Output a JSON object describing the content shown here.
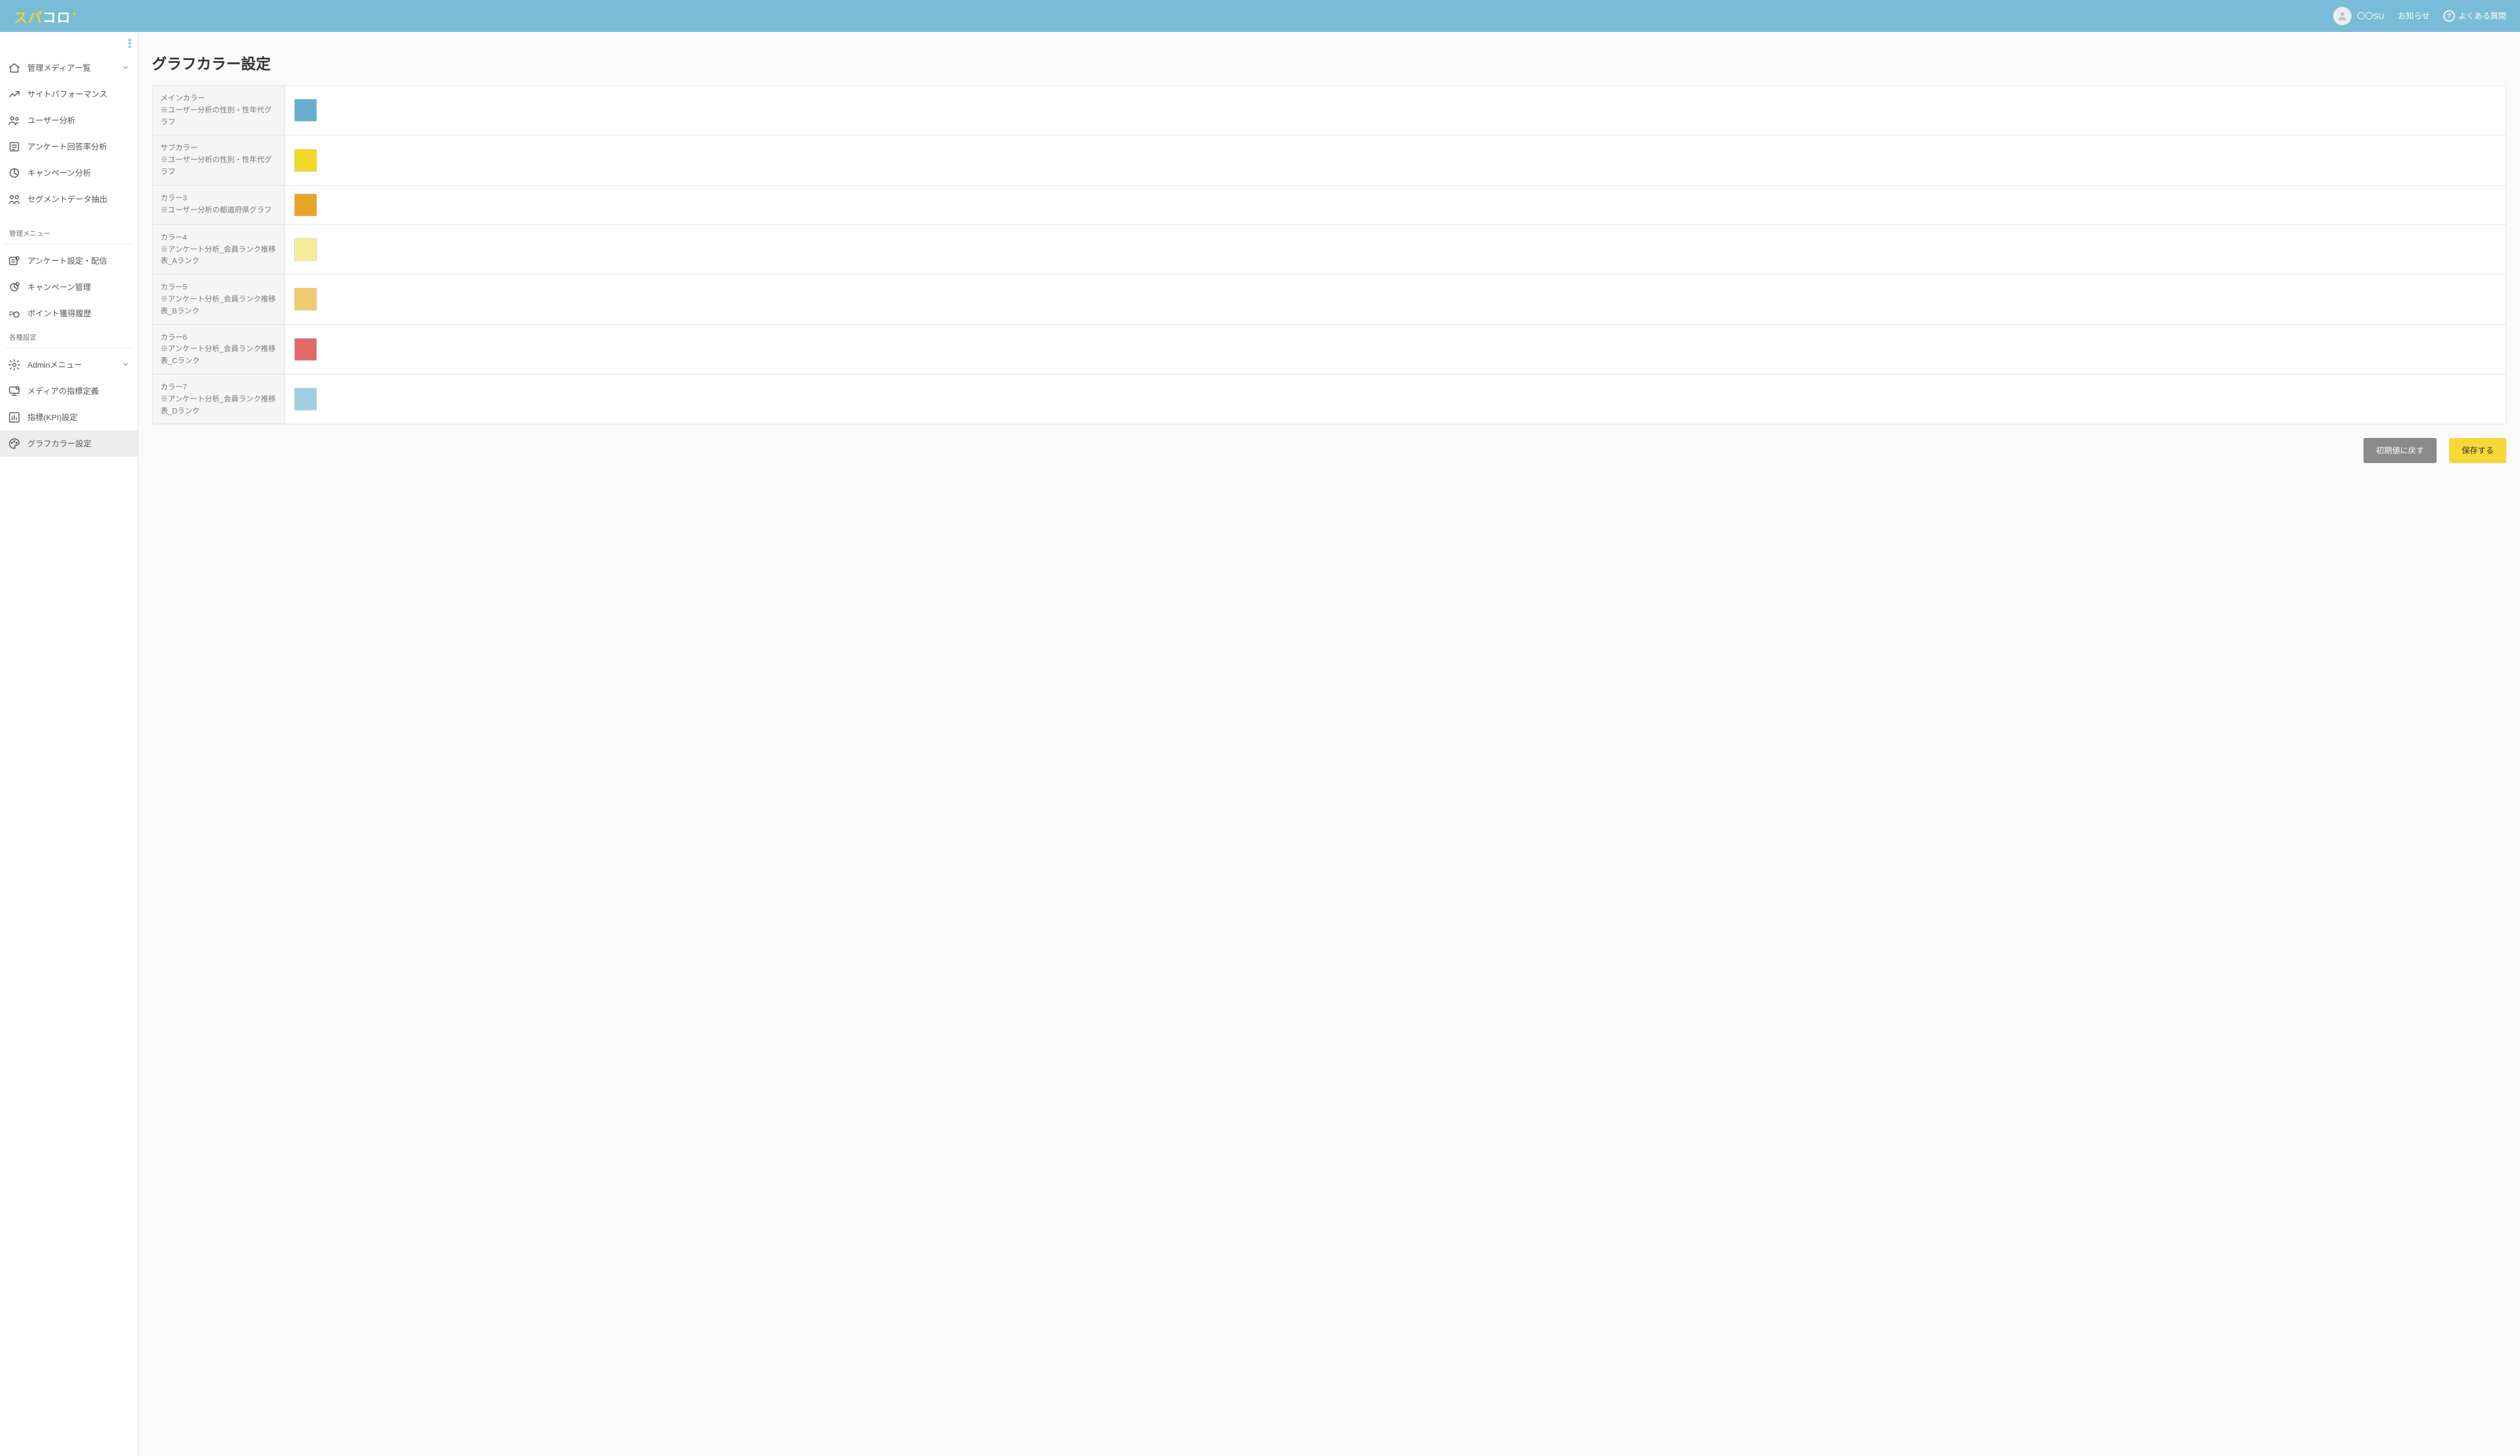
{
  "header": {
    "logo_left": "スパ",
    "logo_right": "コロ",
    "logo_plus": "+",
    "user_name": "〇〇SU",
    "notice_label": "お知らせ",
    "faq_label": "よくある質問"
  },
  "sidebar": {
    "groups": [
      {
        "items": [
          {
            "label": "管理メディア一覧",
            "icon": "home-icon",
            "expandable": true
          },
          {
            "label": "サイトパフォーマンス",
            "icon": "trend-icon"
          },
          {
            "label": "ユーザー分析",
            "icon": "users-icon"
          },
          {
            "label": "アンケート回答率分析",
            "icon": "survey-icon"
          },
          {
            "label": "キャンペーン分析",
            "icon": "campaign-analysis-icon"
          },
          {
            "label": "セグメントデータ抽出",
            "icon": "segment-icon"
          }
        ]
      },
      {
        "title": "管理メニュー",
        "items": [
          {
            "label": "アンケート設定・配信",
            "icon": "survey-gear-icon"
          },
          {
            "label": "キャンペーン管理",
            "icon": "campaign-gear-icon"
          },
          {
            "label": "ポイント獲得履歴",
            "icon": "point-icon"
          }
        ]
      },
      {
        "title": "各種設定",
        "items": [
          {
            "label": "Adminメニュー",
            "icon": "gear-icon",
            "expandable": true
          },
          {
            "label": "メディアの指標定義",
            "icon": "monitor-icon"
          },
          {
            "label": "指標(KPI)設定",
            "icon": "kpi-icon"
          },
          {
            "label": "グラフカラー設定",
            "icon": "palette-icon",
            "active": true
          }
        ]
      }
    ]
  },
  "page": {
    "title": "グラフカラー設定",
    "rows": [
      {
        "name": "メインカラー",
        "note": "※ユーザー分析の性別・性年代グラフ",
        "color": "#67aecd"
      },
      {
        "name": "サブカラー",
        "note": "※ユーザー分析の性別・性年代グラフ",
        "color": "#f4d828"
      },
      {
        "name": "カラー3",
        "note": "※ユーザー分析の都道府県グラフ",
        "color": "#e6a527"
      },
      {
        "name": "カラー4",
        "note": "※アンケート分析_会員ランク推移表_Aランク",
        "color": "#f5ec9c"
      },
      {
        "name": "カラー5",
        "note": "※アンケート分析_会員ランク推移表_Bランク",
        "color": "#f0cc71"
      },
      {
        "name": "カラー6",
        "note": "※アンケート分析_会員ランク推移表_Cランク",
        "color": "#e36a6a"
      },
      {
        "name": "カラー7",
        "note": "※アンケート分析_会員ランク推移表_Dランク",
        "color": "#9fcfdf"
      }
    ],
    "reset_label": "初期値に戻す",
    "save_label": "保存する"
  }
}
